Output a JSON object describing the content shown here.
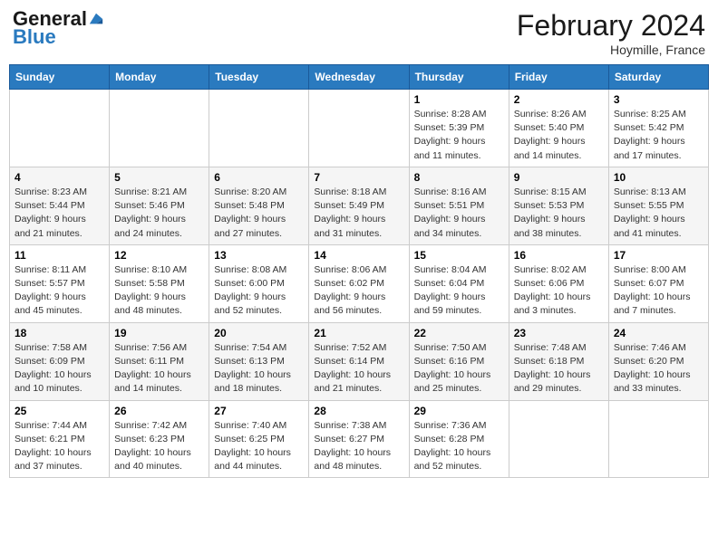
{
  "header": {
    "logo_line1": "General",
    "logo_line2": "Blue",
    "month_year": "February 2024",
    "location": "Hoymille, France"
  },
  "weekdays": [
    "Sunday",
    "Monday",
    "Tuesday",
    "Wednesday",
    "Thursday",
    "Friday",
    "Saturday"
  ],
  "weeks": [
    [
      {
        "day": "",
        "info": ""
      },
      {
        "day": "",
        "info": ""
      },
      {
        "day": "",
        "info": ""
      },
      {
        "day": "",
        "info": ""
      },
      {
        "day": "1",
        "info": "Sunrise: 8:28 AM\nSunset: 5:39 PM\nDaylight: 9 hours\nand 11 minutes."
      },
      {
        "day": "2",
        "info": "Sunrise: 8:26 AM\nSunset: 5:40 PM\nDaylight: 9 hours\nand 14 minutes."
      },
      {
        "day": "3",
        "info": "Sunrise: 8:25 AM\nSunset: 5:42 PM\nDaylight: 9 hours\nand 17 minutes."
      }
    ],
    [
      {
        "day": "4",
        "info": "Sunrise: 8:23 AM\nSunset: 5:44 PM\nDaylight: 9 hours\nand 21 minutes."
      },
      {
        "day": "5",
        "info": "Sunrise: 8:21 AM\nSunset: 5:46 PM\nDaylight: 9 hours\nand 24 minutes."
      },
      {
        "day": "6",
        "info": "Sunrise: 8:20 AM\nSunset: 5:48 PM\nDaylight: 9 hours\nand 27 minutes."
      },
      {
        "day": "7",
        "info": "Sunrise: 8:18 AM\nSunset: 5:49 PM\nDaylight: 9 hours\nand 31 minutes."
      },
      {
        "day": "8",
        "info": "Sunrise: 8:16 AM\nSunset: 5:51 PM\nDaylight: 9 hours\nand 34 minutes."
      },
      {
        "day": "9",
        "info": "Sunrise: 8:15 AM\nSunset: 5:53 PM\nDaylight: 9 hours\nand 38 minutes."
      },
      {
        "day": "10",
        "info": "Sunrise: 8:13 AM\nSunset: 5:55 PM\nDaylight: 9 hours\nand 41 minutes."
      }
    ],
    [
      {
        "day": "11",
        "info": "Sunrise: 8:11 AM\nSunset: 5:57 PM\nDaylight: 9 hours\nand 45 minutes."
      },
      {
        "day": "12",
        "info": "Sunrise: 8:10 AM\nSunset: 5:58 PM\nDaylight: 9 hours\nand 48 minutes."
      },
      {
        "day": "13",
        "info": "Sunrise: 8:08 AM\nSunset: 6:00 PM\nDaylight: 9 hours\nand 52 minutes."
      },
      {
        "day": "14",
        "info": "Sunrise: 8:06 AM\nSunset: 6:02 PM\nDaylight: 9 hours\nand 56 minutes."
      },
      {
        "day": "15",
        "info": "Sunrise: 8:04 AM\nSunset: 6:04 PM\nDaylight: 9 hours\nand 59 minutes."
      },
      {
        "day": "16",
        "info": "Sunrise: 8:02 AM\nSunset: 6:06 PM\nDaylight: 10 hours\nand 3 minutes."
      },
      {
        "day": "17",
        "info": "Sunrise: 8:00 AM\nSunset: 6:07 PM\nDaylight: 10 hours\nand 7 minutes."
      }
    ],
    [
      {
        "day": "18",
        "info": "Sunrise: 7:58 AM\nSunset: 6:09 PM\nDaylight: 10 hours\nand 10 minutes."
      },
      {
        "day": "19",
        "info": "Sunrise: 7:56 AM\nSunset: 6:11 PM\nDaylight: 10 hours\nand 14 minutes."
      },
      {
        "day": "20",
        "info": "Sunrise: 7:54 AM\nSunset: 6:13 PM\nDaylight: 10 hours\nand 18 minutes."
      },
      {
        "day": "21",
        "info": "Sunrise: 7:52 AM\nSunset: 6:14 PM\nDaylight: 10 hours\nand 21 minutes."
      },
      {
        "day": "22",
        "info": "Sunrise: 7:50 AM\nSunset: 6:16 PM\nDaylight: 10 hours\nand 25 minutes."
      },
      {
        "day": "23",
        "info": "Sunrise: 7:48 AM\nSunset: 6:18 PM\nDaylight: 10 hours\nand 29 minutes."
      },
      {
        "day": "24",
        "info": "Sunrise: 7:46 AM\nSunset: 6:20 PM\nDaylight: 10 hours\nand 33 minutes."
      }
    ],
    [
      {
        "day": "25",
        "info": "Sunrise: 7:44 AM\nSunset: 6:21 PM\nDaylight: 10 hours\nand 37 minutes."
      },
      {
        "day": "26",
        "info": "Sunrise: 7:42 AM\nSunset: 6:23 PM\nDaylight: 10 hours\nand 40 minutes."
      },
      {
        "day": "27",
        "info": "Sunrise: 7:40 AM\nSunset: 6:25 PM\nDaylight: 10 hours\nand 44 minutes."
      },
      {
        "day": "28",
        "info": "Sunrise: 7:38 AM\nSunset: 6:27 PM\nDaylight: 10 hours\nand 48 minutes."
      },
      {
        "day": "29",
        "info": "Sunrise: 7:36 AM\nSunset: 6:28 PM\nDaylight: 10 hours\nand 52 minutes."
      },
      {
        "day": "",
        "info": ""
      },
      {
        "day": "",
        "info": ""
      }
    ]
  ]
}
